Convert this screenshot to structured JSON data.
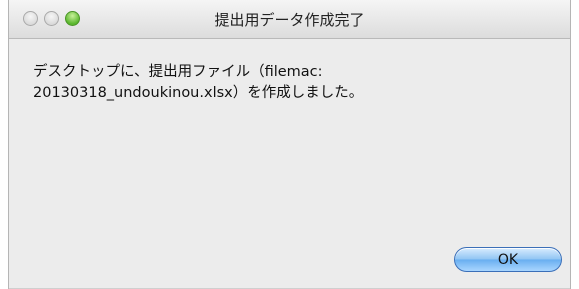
{
  "window": {
    "title": "提出用データ作成完了"
  },
  "message": {
    "line1": "デスクトップに、提出用ファイル（filemac:",
    "line2": "20130318_undoukinou.xlsx）を作成しました。"
  },
  "buttons": {
    "ok_label": "OK"
  },
  "icons": {
    "close": "close-button",
    "minimize": "minimize-button",
    "zoom": "zoom-button"
  },
  "colors": {
    "window_background": "#ececec",
    "zoom_green": "#5bb72e",
    "default_button_blue": "#68aef0"
  }
}
